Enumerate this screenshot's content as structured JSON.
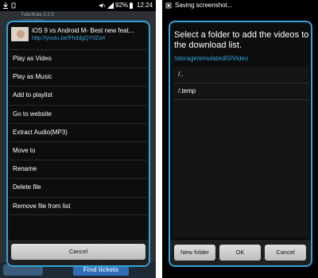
{
  "left": {
    "status_bar": {
      "signal_text": "92%",
      "time": "12:24"
    },
    "background_app": {
      "title": "TubeMate 2.2.5",
      "subtitle": "Latest Videos",
      "banner_button": "Find tickets"
    },
    "dialog": {
      "video_title": "iOS 9 vs Android M- Best new feat...",
      "video_url": "http://youtu.be/FhddgQY0Zo4",
      "menu_items": [
        "Play as Video",
        "Play as Music",
        "Add to playlist",
        "Go to website",
        "Extract Audio(MP3)",
        "Move to",
        "Rename",
        "Delete file",
        "Remove file from list"
      ],
      "cancel_label": "Cancel"
    }
  },
  "right": {
    "notification": "Saving screenshot...",
    "dialog": {
      "title": "Select a folder to add the videos to the download list.",
      "path": "/storage/emulated/0/Video",
      "folders": [
        "/..",
        "/.temp"
      ],
      "new_folder_label": "New folder",
      "ok_label": "OK",
      "cancel_label": "Cancel"
    }
  },
  "colors": {
    "accent": "#32a4d8",
    "link": "#33a8e0",
    "dialog_bg": "#0d0d0d"
  }
}
